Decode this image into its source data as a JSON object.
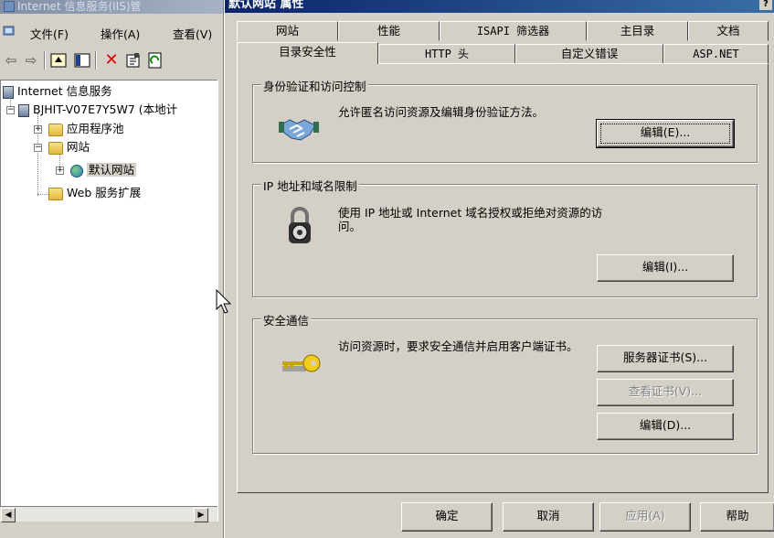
{
  "iis_window": {
    "title": "Internet 信息服务(IIS)管",
    "menu": [
      "文件(F)",
      "操作(A)",
      "查看(V)"
    ],
    "tree": {
      "root": "Internet 信息服务",
      "server": "BJHIT-V07E7Y5W7 (本地计",
      "app_pools": "应用程序池",
      "websites": "网站",
      "default_site": "默认网站",
      "web_ext": "Web 服务扩展"
    }
  },
  "dialog": {
    "title": "默认网站 属性",
    "tabs_row1": [
      "网站",
      "性能",
      "ISAPI 筛选器",
      "主目录",
      "文档"
    ],
    "tabs_row2": [
      "目录安全性",
      "HTTP 头",
      "自定义错误",
      "ASP.NET"
    ],
    "active_tab": "目录安全性",
    "auth_group": {
      "title": "身份验证和访问控制",
      "text": "允许匿名访问资源及编辑身份验证方法。",
      "edit_button": "编辑(E)..."
    },
    "ip_group": {
      "title": "IP 地址和域名限制",
      "text": "使用 IP 地址或 Internet 域名授权或拒绝对资源的访问。",
      "edit_button": "编辑(I)..."
    },
    "secure_group": {
      "title": "安全通信",
      "text": "访问资源时，要求安全通信并启用客户端证书。",
      "server_cert_button": "服务器证书(S)...",
      "view_cert_button": "查看证书(V)...",
      "edit_button": "编辑(D)..."
    },
    "footer": {
      "ok": "确定",
      "cancel": "取消",
      "apply": "应用(A)",
      "help": "帮助"
    }
  }
}
